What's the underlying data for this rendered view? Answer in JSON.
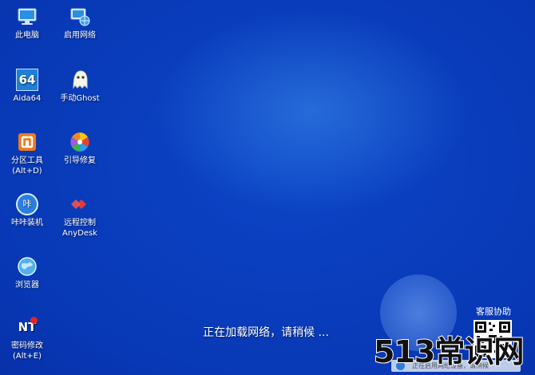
{
  "desktop_icons": [
    {
      "label": "此电脑",
      "sub": ""
    },
    {
      "label": "启用网络",
      "sub": ""
    },
    {
      "label": "Aida64",
      "sub": ""
    },
    {
      "label": "手动Ghost",
      "sub": ""
    },
    {
      "label": "分区工具",
      "sub": "(Alt+D)"
    },
    {
      "label": "引导修复",
      "sub": ""
    },
    {
      "label": "咔咔装机",
      "sub": ""
    },
    {
      "label": "远程控制",
      "sub": "AnyDesk"
    },
    {
      "label": "浏览器",
      "sub": ""
    },
    {
      "label": "密码修改",
      "sub": "(Alt+E)"
    }
  ],
  "status_text": "正在加载网络，请稍候 ...",
  "service": {
    "label": "客服协助"
  },
  "taskbar_notice": "正在启用网络设备，请稍候",
  "watermark": "513常识网",
  "icon_names": {
    "aida": "64",
    "kaka": "咔",
    "password": "NT"
  }
}
